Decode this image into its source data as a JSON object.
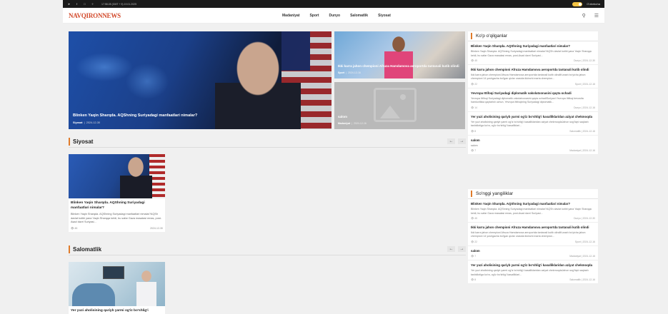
{
  "topbar": {
    "social_icons": [
      "telegram-icon",
      "facebook-icon",
      "instagram-icon",
      "twitter-icon"
    ],
    "datetime": "17:58:28 (GMT + 5) 19.01.2025",
    "language": "O'zbekcha"
  },
  "header": {
    "logo": "NAVQIRONNEWS",
    "nav": [
      "Madaniyat",
      "Sport",
      "Dunyo",
      "Salomatlik",
      "Siyosat"
    ]
  },
  "hero": {
    "title": "Blinken Yaqin Sharqda. AQShning Suriyadagi manfaatlari nimalar?",
    "category": "Siyosat",
    "date": "2024-12-30"
  },
  "featured": [
    {
      "title": "Ikki karra jahon chempioni Afruza Hamdamova aeroportda tantanali kutib olindi",
      "category": "Sport",
      "date": "2024-12-16"
    },
    {
      "title": "salom",
      "category": "Madaniyat",
      "date": "2024-12-16"
    }
  ],
  "sections": [
    {
      "title": "Siyosat",
      "post": {
        "title": "Blinken Yaqin Sharqda. AQShning Suriyadagi manfaatlari nimalar?",
        "excerpt": "Blinken Yaqin Sharqda. AQShning Suriyadagi manfaatlari nimalar?AQSh davlat kotibi yana Yaqin Sharqqa keldi, bu safar Gaza masalasi emas, post-Asad davri Suriyasi...",
        "views": "45",
        "date": "2024-12-30"
      }
    },
    {
      "title": "Salomatlik",
      "post": {
        "title": "Yer yuzi aholisining qariyb yarmi og'iz bo'shlig'i"
      }
    }
  ],
  "sidebar": {
    "popular": {
      "title": "Ko'p o'qilganlar",
      "items": [
        {
          "title": "Blinken Yaqin Sharqda. AQShning Suriyadagi manfaatlari nimalar?",
          "excerpt": "Blinken Yaqin Sharqda. AQShning Suriyadagi manfaatlari nimalar?AQSh davlat kotibi yana Yaqin Sharqqa keldi, bu safar Gaza masalasi emas, post-Asad davri Suriyasi...",
          "views": "45",
          "category": "Dunyo",
          "date": "2024-12-30"
        },
        {
          "title": "Ikki karra jahon chempioni Afruza Hamdamova aeroportda tantanali kutib olindi",
          "excerpt": "Ikki karra jahon chempioni Afruza Hamdamova aeroportda tantanali kutib olindiKurash bo'yicha jahon chempioni 14 yoshgacha bo'lgan qizlar orasida ikkinchi marta chempion...",
          "views": "22",
          "category": "Sport",
          "date": "2024-12-16"
        },
        {
          "title": "Yevropa Ittifoqi Suriyadagi diplomatik vakolatxonasini qayta ochadi",
          "excerpt": "Yevropa Ittifoqi Suriyadagi diplomatik vakolatxonasini qayta ochadiSuriyani Yevropa Ittifoqi bevosita hamkorlikka qaytarish uchun, Yevropa Ittifoqining Suriyadagi diplomatik...",
          "views": "14",
          "category": "Dunyo",
          "date": "2024-12-16"
        },
        {
          "title": "Yer yuzi aholisining qariyb yarmi og'iz bo'shlig'i kasalliklaridan aziyat chekmoqda",
          "excerpt": "Yer yuzi aholisining qariyb yarmi og'iz bo'shlig'i kasalliklaridan aziyat chekmoqdaJahon sog'liqni saqlash tashkilotiga ko'ra, og'iz bo'shlig'i kasalliklari...",
          "views": "8",
          "category": "Salomatlik",
          "date": "2024-12-16"
        },
        {
          "title": "salom",
          "excerpt": "salom",
          "views": "7",
          "category": "Madaniyat",
          "date": "2024-12-16"
        }
      ]
    },
    "latest": {
      "title": "So'nggi yangiliklar",
      "items": [
        {
          "title": "Blinken Yaqin Sharqda. AQShning Suriyadagi manfaatlari nimalar?",
          "excerpt": "Blinken Yaqin Sharqda. AQShning Suriyadagi manfaatlari nimalar?AQSh davlat kotibi yana Yaqin Sharqqa keldi, bu safar Gaza masalasi emas, post-Asad davri Suriyasi...",
          "views": "45",
          "category": "Dunyo",
          "date": "2024-12-30"
        },
        {
          "title": "Ikki karra jahon chempioni Afruza Hamdamova aeroportda tantanali kutib olindi",
          "excerpt": "Ikki karra jahon chempioni Afruza Hamdamova aeroportda tantanali kutib olindiKurash bo'yicha jahon chempioni 14 yoshgacha bo'lgan qizlar orasida ikkinchi marta chempion...",
          "views": "22",
          "category": "Sport",
          "date": "2024-12-16"
        },
        {
          "title": "salom",
          "excerpt": "",
          "views": "7",
          "category": "Madaniyat",
          "date": "2024-12-16"
        },
        {
          "title": "Yer yuzi aholisining qariyb yarmi og'iz bo'shlig'i kasalliklaridan aziyat chekmoqda",
          "excerpt": "Yer yuzi aholisining qariyb yarmi og'iz bo'shlig'i kasalliklaridan aziyat chekmoqdaJahon sog'liqni saqlash tashkilotiga ko'ra, og'iz bo'shlig'i kasalliklari...",
          "views": "8",
          "category": "Salomatlik",
          "date": "2024-12-16"
        }
      ]
    }
  }
}
